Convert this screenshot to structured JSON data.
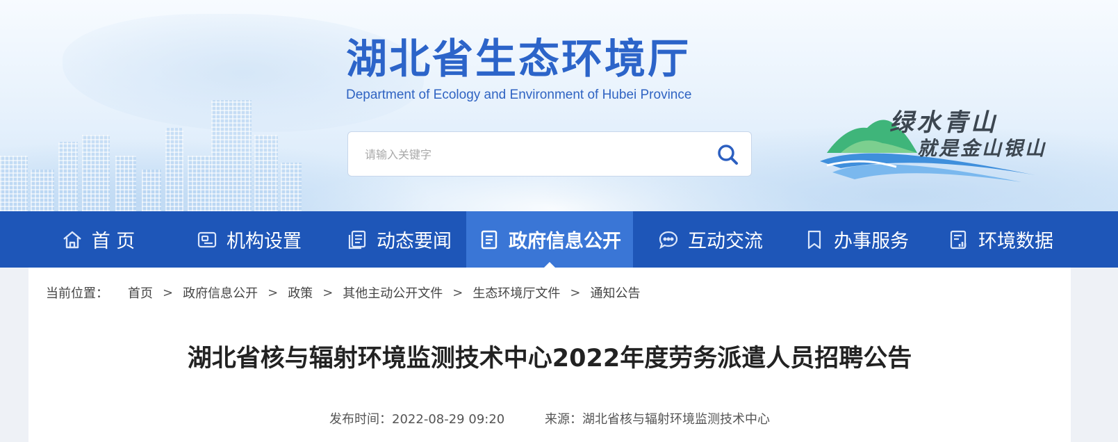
{
  "header": {
    "title_cn": "湖北省生态环境厅",
    "title_en": "Department of Ecology and Environment of Hubei Province",
    "slogan_line1": "绿水青山",
    "slogan_line2": "就是金山银山"
  },
  "search": {
    "placeholder": "请输入关键字",
    "value": ""
  },
  "nav": {
    "items": [
      {
        "label": "首 页",
        "icon": "home-icon"
      },
      {
        "label": "机构设置",
        "icon": "org-icon"
      },
      {
        "label": "动态要闻",
        "icon": "news-icon"
      },
      {
        "label": "政府信息公开",
        "icon": "document-icon",
        "active": true
      },
      {
        "label": "互动交流",
        "icon": "chat-icon"
      },
      {
        "label": "办事服务",
        "icon": "bookmark-icon"
      },
      {
        "label": "环境数据",
        "icon": "data-icon"
      }
    ]
  },
  "breadcrumb": {
    "label": "当前位置：",
    "separator": ">",
    "items": [
      "首页",
      "政府信息公开",
      "政策",
      "其他主动公开文件",
      "生态环境厅文件",
      "通知公告"
    ]
  },
  "article": {
    "title": "湖北省核与辐射环境监测技术中心2022年度劳务派遣人员招聘公告",
    "publish_time_label": "发布时间：",
    "publish_time": "2022-08-29 09:20",
    "source_label": "来源：",
    "source": "湖北省核与辐射环境监测技术中心"
  },
  "colors": {
    "brand_blue": "#1e56b8",
    "nav_active": "#3a76d6",
    "title_blue": "#2c64c9"
  }
}
